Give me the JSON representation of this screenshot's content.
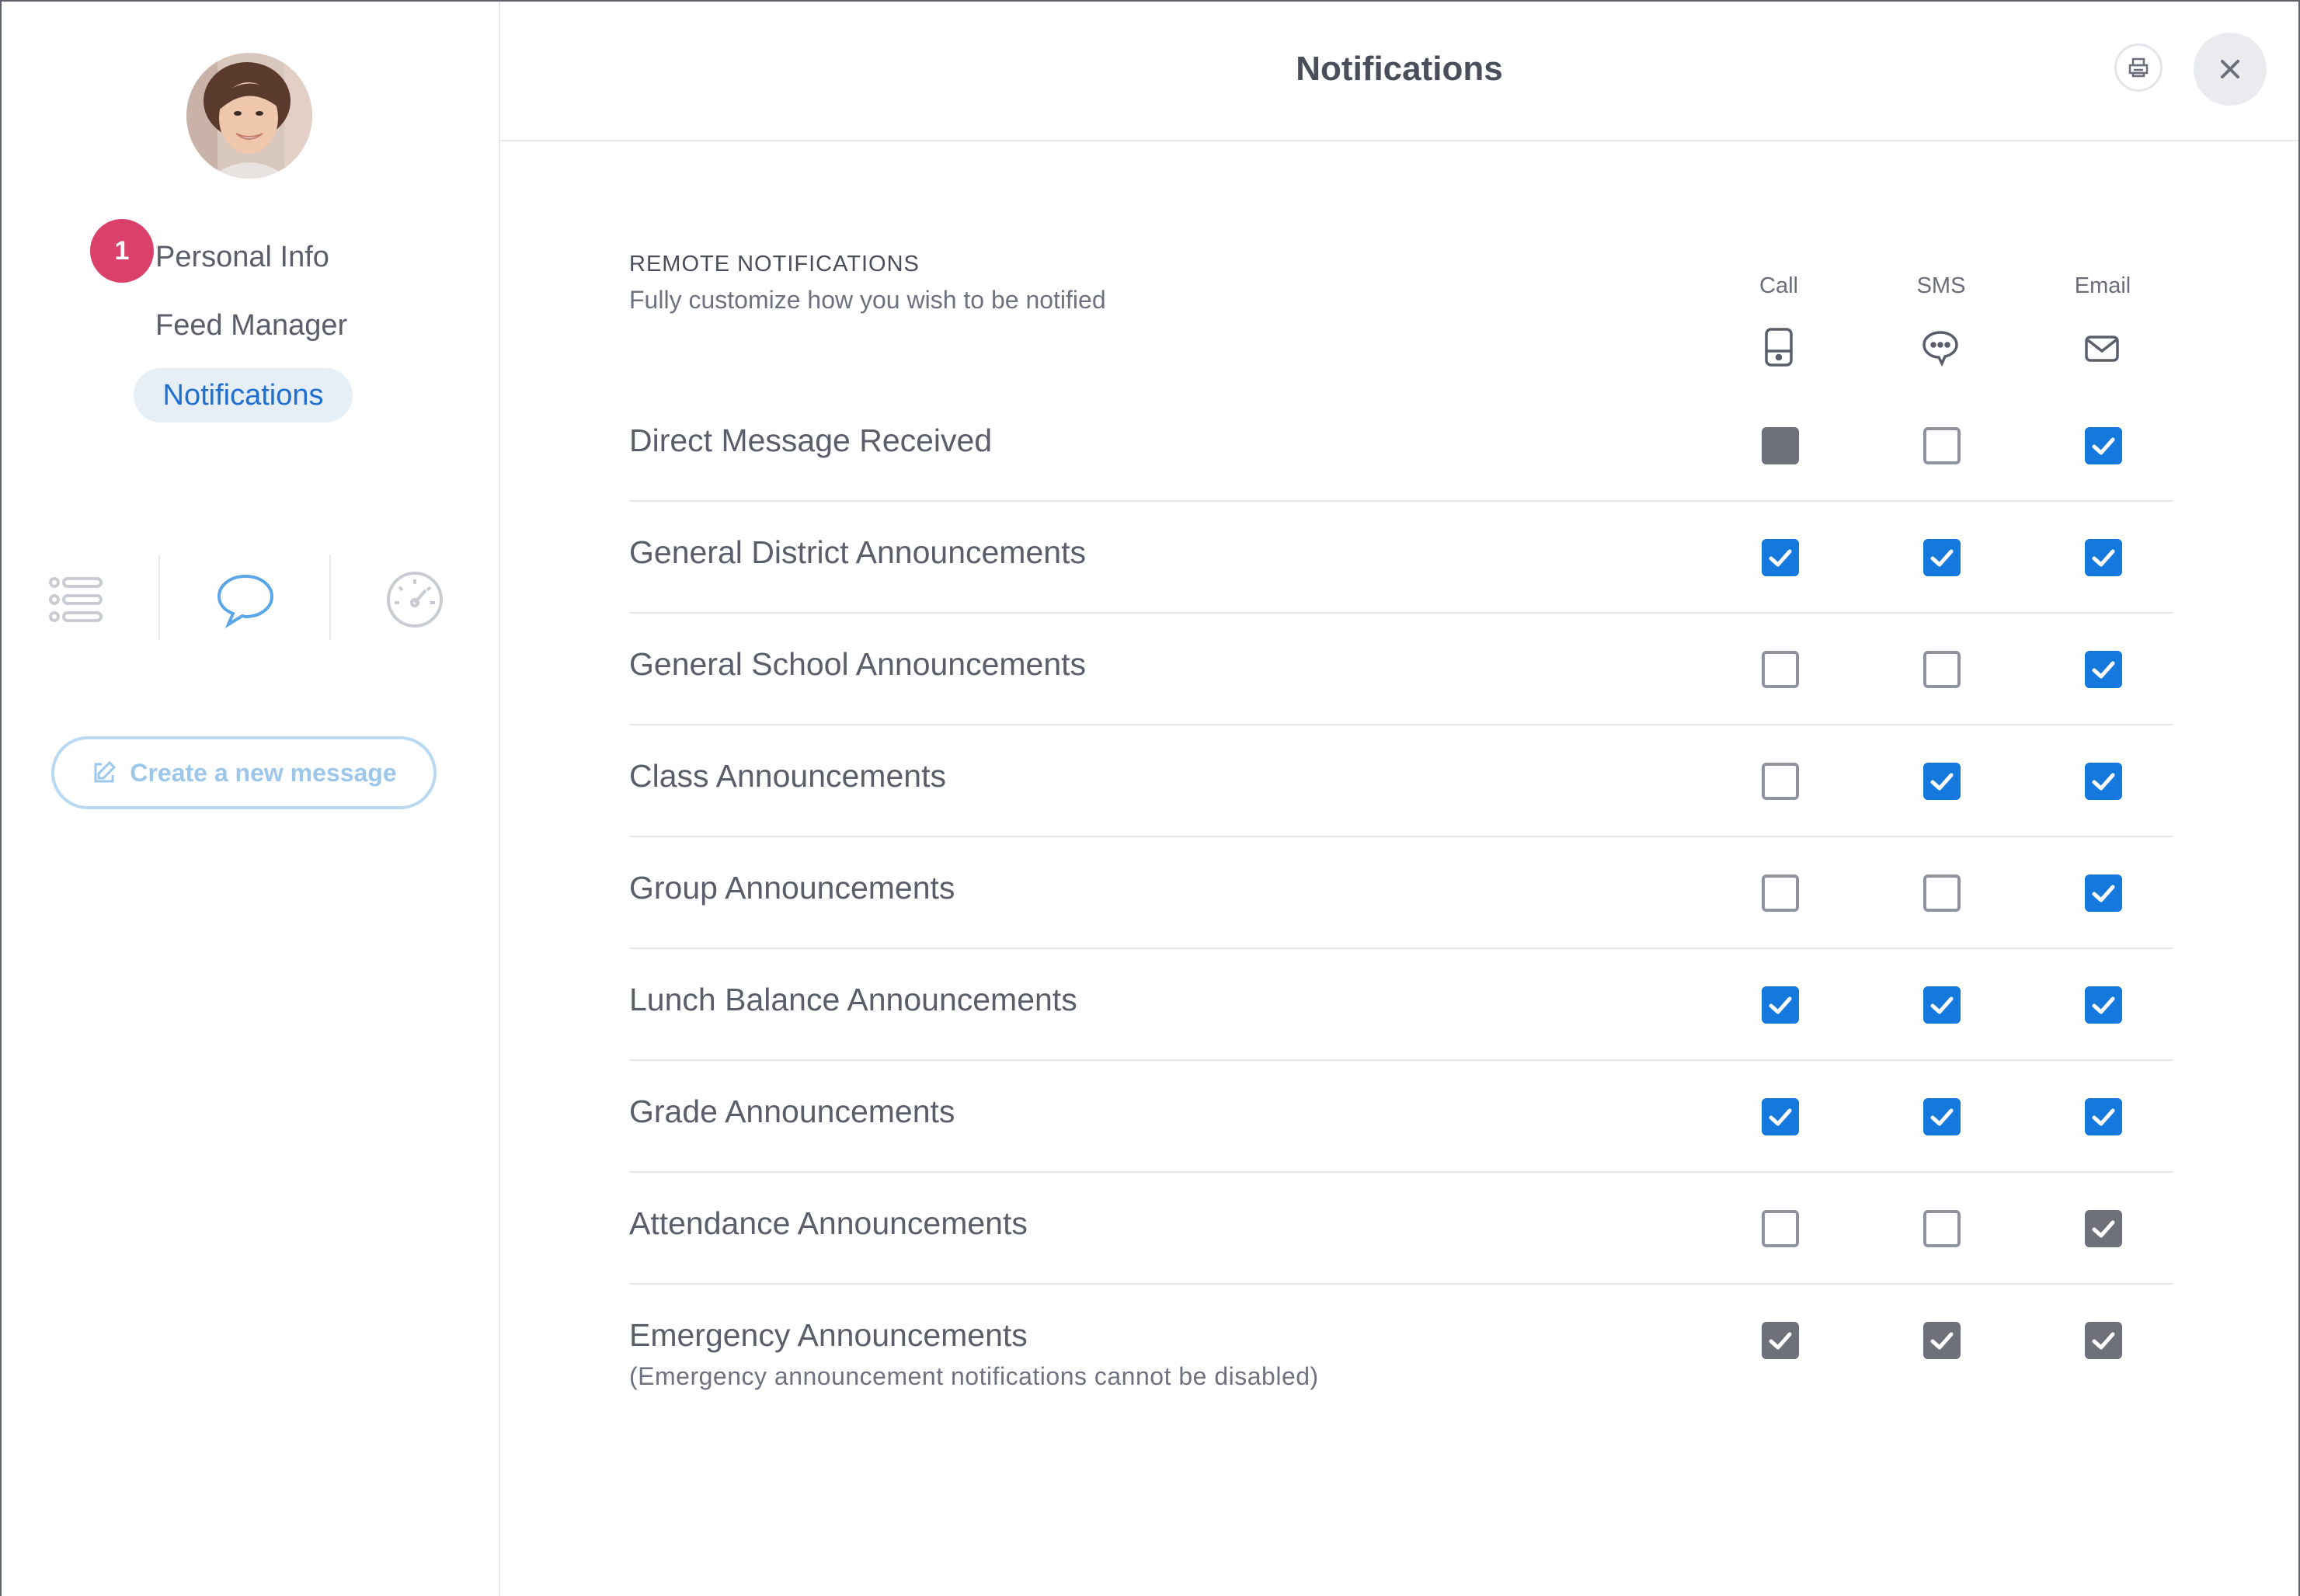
{
  "header": {
    "title": "Notifications"
  },
  "sidebar": {
    "badge": "1",
    "nav": {
      "personal_info": "Personal Info",
      "feed_manager": "Feed Manager",
      "notifications": "Notifications"
    },
    "create_button": "Create a new message"
  },
  "section": {
    "title": "REMOTE NOTIFICATIONS",
    "subtitle": "Fully customize how you wish to be notified"
  },
  "columns": {
    "call": "Call",
    "sms": "SMS",
    "email": "Email"
  },
  "rows": [
    {
      "label": "Direct Message Received",
      "call": "disabled",
      "sms": "unchecked",
      "email": "checked"
    },
    {
      "label": "General District Announcements",
      "call": "checked",
      "sms": "checked",
      "email": "checked"
    },
    {
      "label": "General School Announcements",
      "call": "unchecked",
      "sms": "unchecked",
      "email": "checked"
    },
    {
      "label": "Class Announcements",
      "call": "unchecked",
      "sms": "checked",
      "email": "checked"
    },
    {
      "label": "Group Announcements",
      "call": "unchecked",
      "sms": "unchecked",
      "email": "checked"
    },
    {
      "label": "Lunch Balance Announcements",
      "call": "checked",
      "sms": "checked",
      "email": "checked"
    },
    {
      "label": "Grade Announcements",
      "call": "checked",
      "sms": "checked",
      "email": "checked"
    },
    {
      "label": "Attendance Announcements",
      "call": "unchecked",
      "sms": "unchecked",
      "email": "locked"
    },
    {
      "label": "Emergency Announcements",
      "sublabel": "(Emergency announcement notifications cannot be disabled)",
      "call": "locked",
      "sms": "locked",
      "email": "locked"
    }
  ],
  "colors": {
    "accent": "#1478dc",
    "badge": "#d9416a",
    "locked": "#6e717a"
  }
}
